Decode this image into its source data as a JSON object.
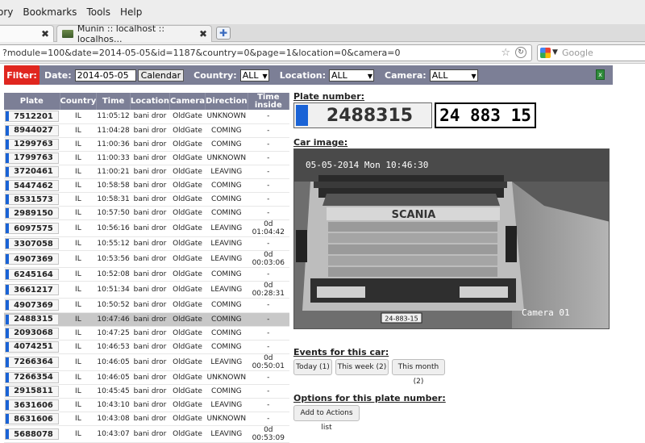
{
  "browser": {
    "menu": [
      {
        "label": "ory",
        "name": "history"
      },
      {
        "label": "Bookmarks",
        "name": "bookmarks"
      },
      {
        "label": "Tools",
        "name": "tools"
      },
      {
        "label": "Help",
        "name": "help"
      }
    ],
    "tabs": [
      {
        "title": ""
      },
      {
        "title": "Munin :: localhost :: localhos..."
      }
    ],
    "url": "?module=100&date=2014-05-05&id=1187&country=0&page=1&location=0&camera=0",
    "search_placeholder": "Google"
  },
  "filter": {
    "button": "Filter:",
    "date_label": "Date:",
    "date_value": "2014-05-05",
    "calendar_button": "Calendar",
    "country_label": "Country:",
    "country_value": "ALL",
    "location_label": "Location:",
    "location_value": "ALL",
    "camera_label": "Camera:",
    "camera_value": "ALL"
  },
  "table": {
    "headers": [
      "Plate",
      "Country",
      "Time",
      "Location",
      "Camera",
      "Direction",
      "Time inside"
    ],
    "rows": [
      [
        "7512201",
        "IL",
        "11:05:12",
        "bani dror",
        "OldGate",
        "UNKNOWN",
        "-"
      ],
      [
        "8944027",
        "IL",
        "11:04:28",
        "bani dror",
        "OldGate",
        "COMING",
        "-"
      ],
      [
        "1299763",
        "IL",
        "11:00:36",
        "bani dror",
        "OldGate",
        "COMING",
        "-"
      ],
      [
        "1799763",
        "IL",
        "11:00:33",
        "bani dror",
        "OldGate",
        "UNKNOWN",
        "-"
      ],
      [
        "3720461",
        "IL",
        "11:00:21",
        "bani dror",
        "OldGate",
        "LEAVING",
        "-"
      ],
      [
        "5447462",
        "IL",
        "10:58:58",
        "bani dror",
        "OldGate",
        "COMING",
        "-"
      ],
      [
        "8531573",
        "IL",
        "10:58:31",
        "bani dror",
        "OldGate",
        "COMING",
        "-"
      ],
      [
        "2989150",
        "IL",
        "10:57:50",
        "bani dror",
        "OldGate",
        "COMING",
        "-"
      ],
      [
        "6097575",
        "IL",
        "10:56:16",
        "bani dror",
        "OldGate",
        "LEAVING",
        "0d 01:04:42"
      ],
      [
        "3307058",
        "IL",
        "10:55:12",
        "bani dror",
        "OldGate",
        "LEAVING",
        "-"
      ],
      [
        "4907369",
        "IL",
        "10:53:56",
        "bani dror",
        "OldGate",
        "LEAVING",
        "0d 00:03:06"
      ],
      [
        "6245164",
        "IL",
        "10:52:08",
        "bani dror",
        "OldGate",
        "COMING",
        "-"
      ],
      [
        "3661217",
        "IL",
        "10:51:34",
        "bani dror",
        "OldGate",
        "LEAVING",
        "0d 00:28:31"
      ],
      [
        "4907369",
        "IL",
        "10:50:52",
        "bani dror",
        "OldGate",
        "COMING",
        "-"
      ],
      [
        "2488315",
        "IL",
        "10:47:46",
        "bani dror",
        "OldGate",
        "COMING",
        "-"
      ],
      [
        "2093068",
        "IL",
        "10:47:25",
        "bani dror",
        "OldGate",
        "COMING",
        "-"
      ],
      [
        "4074251",
        "IL",
        "10:46:53",
        "bani dror",
        "OldGate",
        "COMING",
        "-"
      ],
      [
        "7266364",
        "IL",
        "10:46:05",
        "bani dror",
        "OldGate",
        "LEAVING",
        "0d 00:50:01"
      ],
      [
        "7266354",
        "IL",
        "10:46:05",
        "bani dror",
        "OldGate",
        "UNKNOWN",
        "-"
      ],
      [
        "2915811",
        "IL",
        "10:45:45",
        "bani dror",
        "OldGate",
        "COMING",
        "-"
      ],
      [
        "3631606",
        "IL",
        "10:43:10",
        "bani dror",
        "OldGate",
        "LEAVING",
        "-"
      ],
      [
        "8631606",
        "IL",
        "10:43:08",
        "bani dror",
        "OldGate",
        "UNKNOWN",
        "-"
      ],
      [
        "5688078",
        "IL",
        "10:43:07",
        "bani dror",
        "OldGate",
        "LEAVING",
        "0d 00:53:09"
      ]
    ],
    "selected_index": 14
  },
  "detail": {
    "plate_title": "Plate number:",
    "plate_value": "2488315",
    "plate_image_text": "24 883 15",
    "car_image_title": "Car image:",
    "image_timestamp": "05-05-2014 Mon 10:46:30",
    "image_camera": "Camera 01",
    "image_brand": "SCANIA",
    "image_front_plate": "24-883-15",
    "events_title": "Events for this car:",
    "events_buttons": [
      "Today (1)",
      "This week (2)",
      "This month (2)"
    ],
    "options_title": "Options for this plate number:",
    "options_button": "Add to Actions list"
  },
  "colors": {
    "filter_bg": "#7c7f96",
    "filter_button": "#e0261f",
    "plate_blue": "#1a63d6",
    "selected_row": "#c8c8c8"
  }
}
